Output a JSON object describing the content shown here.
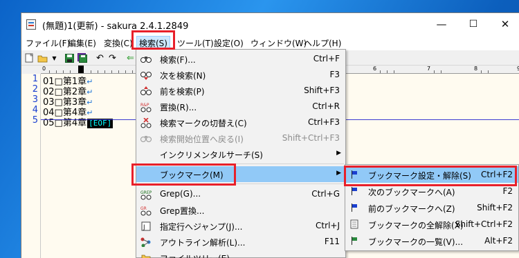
{
  "window": {
    "title": "(無題)1(更新) - sakura 2.4.1.2849",
    "minimize": "—",
    "maximize": "☐",
    "close": "✕"
  },
  "menubar": [
    {
      "label": "ファイル(F)"
    },
    {
      "label": "編集(E)"
    },
    {
      "label": "変換(C)"
    },
    {
      "label": "検索(S)",
      "active": true
    },
    {
      "label": "ツール(T)"
    },
    {
      "label": "設定(O)"
    },
    {
      "label": "ウィンドウ(W)"
    },
    {
      "label": "ヘルプ(H)"
    }
  ],
  "ruler": {
    "mark0": "0",
    "mark6": "6",
    "mark7": "7",
    "mark8": "8",
    "mark9": "9"
  },
  "editor": {
    "line_numbers": [
      "1",
      "2",
      "3",
      "4",
      "5"
    ],
    "lines": [
      "01□第1章",
      "02□第2章",
      "03□第3章",
      "04□第4章",
      "05□第4章"
    ],
    "eol_marker": "↵",
    "eof_marker": "[EOF]"
  },
  "search_menu": {
    "items": [
      {
        "label": "検索(F)...",
        "shortcut": "Ctrl+F"
      },
      {
        "label": "次を検索(N)",
        "shortcut": "F3"
      },
      {
        "label": "前を検索(P)",
        "shortcut": "Shift+F3"
      },
      {
        "label": "置換(R)...",
        "shortcut": "Ctrl+R"
      },
      {
        "label": "検索マークの切替え(C)",
        "shortcut": "Ctrl+F3"
      },
      {
        "label": "検索開始位置へ戻る(I)",
        "shortcut": "Shift+Ctrl+F3",
        "disabled": true
      },
      {
        "label": "インクリメンタルサーチ(S)",
        "shortcut": ""
      },
      {
        "label": "ブックマーク(M)",
        "shortcut": "",
        "highlighted": true
      },
      {
        "label": "Grep(G)...",
        "shortcut": "Ctrl+G"
      },
      {
        "label": "Grep置換...",
        "shortcut": ""
      },
      {
        "label": "指定行へジャンプ(J)...",
        "shortcut": "Ctrl+J"
      },
      {
        "label": "アウトライン解析(L)...",
        "shortcut": "F11"
      },
      {
        "label": "ファイルツリー(E)",
        "shortcut": ""
      }
    ]
  },
  "bookmark_submenu": {
    "items": [
      {
        "label": "ブックマーク設定・解除(S)",
        "shortcut": "Ctrl+F2",
        "highlighted": true
      },
      {
        "label": "次のブックマークへ(A)",
        "shortcut": "F2"
      },
      {
        "label": "前のブックマークへ(Z)",
        "shortcut": "Shift+F2"
      },
      {
        "label": "ブックマークの全解除(X)",
        "shortcut": "Shift+Ctrl+F2"
      },
      {
        "label": "ブックマークの一覧(V)...",
        "shortcut": "Alt+F2"
      }
    ]
  },
  "colors": {
    "highlight": "#91c9f7",
    "redbox": "#e8202a",
    "line_number": "#1a3fd0",
    "editor_bg": "#fffbf0"
  }
}
